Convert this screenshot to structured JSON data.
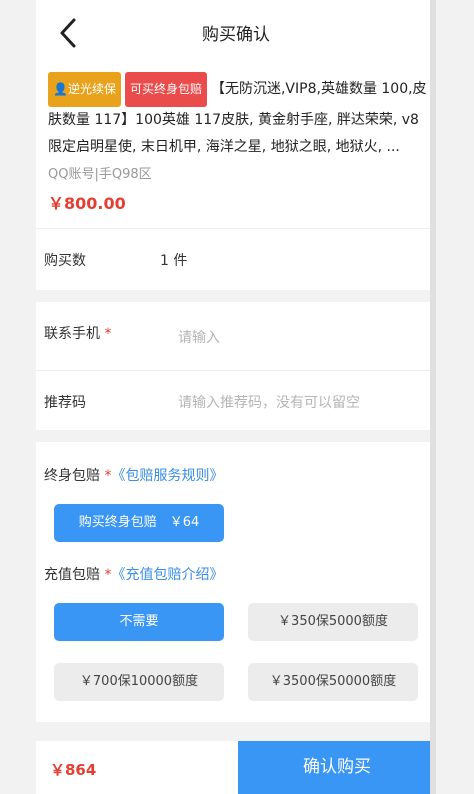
{
  "header": {
    "title": "购买确认"
  },
  "product": {
    "tag_1": "逆光续保",
    "tag_2": "可买终身包赔",
    "description": "【无防沉迷,VIP8,英雄数量 100,皮肤数量 117】100英雄 117皮肤, 黄金射手座, 胖达荣荣, v8限定启明星使, 末日机甲, 海洋之星, 地狱之眼, 地狱火, ...",
    "sub": "QQ账号|手Q98区",
    "price": "￥800.00"
  },
  "quantity": {
    "label": "购买数",
    "value": "1 件"
  },
  "phone": {
    "label": "联系手机",
    "required": "*",
    "placeholder": "请输入"
  },
  "referral": {
    "label": "推荐码",
    "placeholder": "请输入推荐码，没有可以留空"
  },
  "lifetime": {
    "label": "终身包赔",
    "required": "*",
    "link": "《包赔服务规则》",
    "button": "购买终身包赔　￥64"
  },
  "recharge": {
    "label": "充值包赔",
    "required": "*",
    "link": "《充值包赔介绍》",
    "options": [
      "不需要",
      "￥350保5000额度",
      "￥700保10000额度",
      "￥3500保50000额度"
    ]
  },
  "footer": {
    "total": "￥864",
    "confirm": "确认购买"
  },
  "colors": {
    "accent": "#3a96f5",
    "price": "#e53f33",
    "tag_gold": "#e9a21b",
    "tag_red": "#ea4b4b"
  }
}
